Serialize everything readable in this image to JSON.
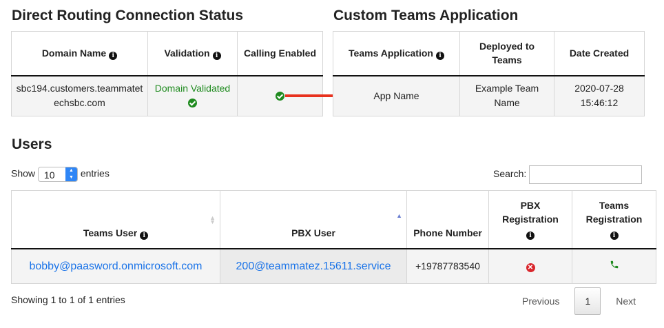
{
  "direct_routing": {
    "title": "Direct Routing Connection Status",
    "headers": {
      "domain_name": "Domain Name",
      "validation": "Validation",
      "calling_enabled": "Calling Enabled"
    },
    "row": {
      "domain": "sbc194.customers.teammatetechsbc.com",
      "validation": "Domain Validated"
    }
  },
  "custom_app": {
    "title": "Custom Teams Application",
    "headers": {
      "teams_application": "Teams Application",
      "deployed_to": "Deployed to Teams",
      "date_created": "Date Created"
    },
    "row": {
      "app_name": "App Name",
      "deployed_to": "Example Team Name",
      "date_created": "2020-07-28 15:46:12"
    }
  },
  "users": {
    "title": "Users",
    "show_label": "Show",
    "entries_value": "10",
    "entries_label": "entries",
    "search_label": "Search:",
    "headers": {
      "teams_user": "Teams User",
      "pbx_user": "PBX User",
      "phone_number": "Phone Number",
      "pbx_registration": "PBX Registration",
      "teams_registration": "Teams Registration"
    },
    "rows": [
      {
        "teams_user": "bobby@paasword.onmicrosoft.com",
        "pbx_user": "200@teammatez.15611.service",
        "phone": "+19787783540",
        "pbx_registered": false,
        "teams_registered": true
      }
    ],
    "info": "Showing 1 to 1 of 1 entries",
    "pagination": {
      "previous": "Previous",
      "current": "1",
      "next": "Next"
    }
  },
  "colors": {
    "accent": "#2f86f6",
    "link": "#1a73e8",
    "success": "#1e8a1e",
    "error": "#d9262c",
    "arrow": "#e8321e"
  },
  "icons": [
    "info-icon",
    "check-circle-icon",
    "x-circle-icon",
    "phone-icon",
    "sort-icon",
    "arrow-right-icon"
  ]
}
